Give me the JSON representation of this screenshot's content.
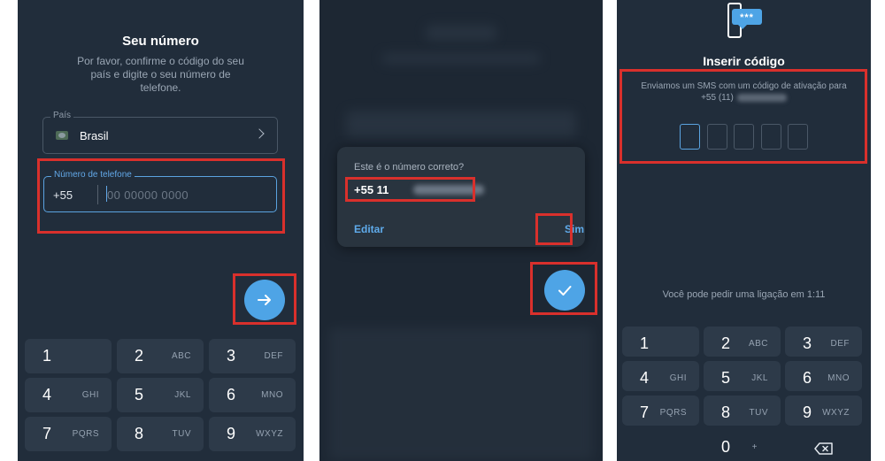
{
  "screen1": {
    "title": "Seu número",
    "subtitle": "Por favor, confirme o código do seu país e digite o seu número de telefone.",
    "country_label": "País",
    "country_value": "Brasil",
    "phone_label": "Número de telefone",
    "country_code": "+55",
    "phone_placeholder": "00 00000 0000",
    "next_icon": "arrow-right-icon"
  },
  "screen2": {
    "question": "Este é o número correto?",
    "number_prefix": "+55 11",
    "edit_label": "Editar",
    "confirm_label": "Sim",
    "done_icon": "checkmark-icon"
  },
  "screen3": {
    "title": "Inserir código",
    "info_line1": "Enviamos um SMS com um código de ativação para",
    "info_line2": "+55 (11)",
    "code_length": 5,
    "call_text": "Você pode pedir uma ligação em 1:11",
    "backspace_icon": "backspace-icon"
  },
  "keypad": [
    {
      "num": "1",
      "letters": ""
    },
    {
      "num": "2",
      "letters": "ABC"
    },
    {
      "num": "3",
      "letters": "DEF"
    },
    {
      "num": "4",
      "letters": "GHI"
    },
    {
      "num": "5",
      "letters": "JKL"
    },
    {
      "num": "6",
      "letters": "MNO"
    },
    {
      "num": "7",
      "letters": "PQRS"
    },
    {
      "num": "8",
      "letters": "TUV"
    },
    {
      "num": "9",
      "letters": "WXYZ"
    }
  ],
  "keypad_zero": {
    "num": "0",
    "letters": "+"
  },
  "colors": {
    "background": "#212d3b",
    "accent": "#4ea4e6",
    "highlight": "#d9302c"
  }
}
